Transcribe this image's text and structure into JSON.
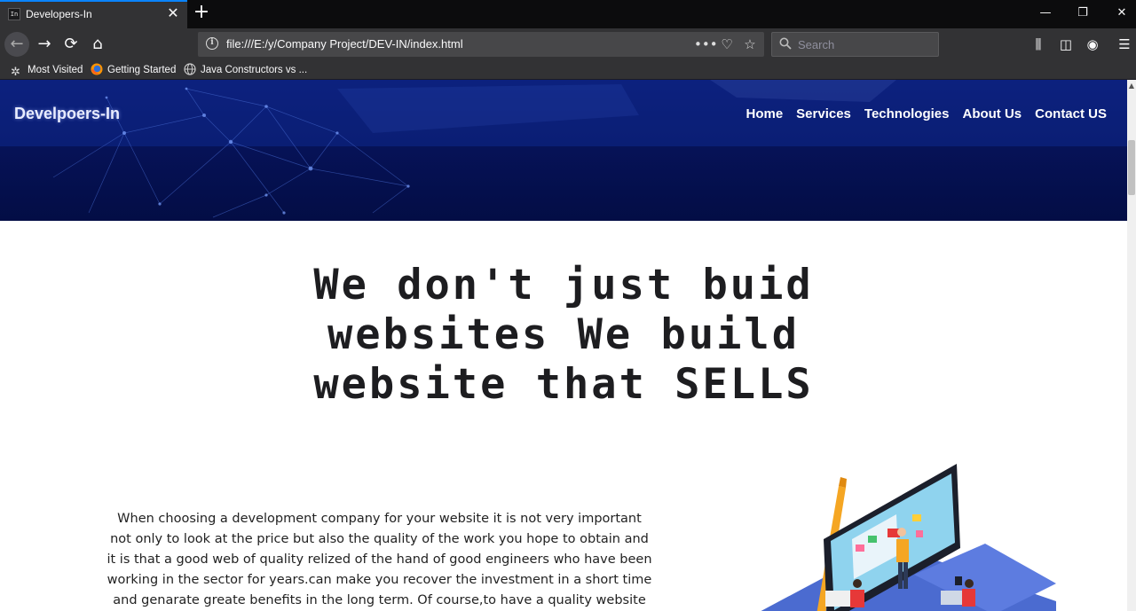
{
  "browser": {
    "tab": {
      "title": "Developers-In",
      "favicon_text": "In",
      "close_icon": "close-icon"
    },
    "new_tab_icon": "plus-icon",
    "window_controls": {
      "minimize": "—",
      "restore": "❐",
      "close": "✕"
    },
    "url": "file:///E:/y/Company Project/DEV-IN/index.html",
    "search_placeholder": "Search",
    "bookmarks": [
      {
        "label": "Most Visited",
        "icon": "gear-icon"
      },
      {
        "label": "Getting Started",
        "icon": "firefox-icon"
      },
      {
        "label": "Java Constructors vs ...",
        "icon": "globe-icon"
      }
    ]
  },
  "site": {
    "brand": "Develpoers-In",
    "nav": [
      "Home",
      "Services",
      "Technologies",
      "About Us",
      "Contact US"
    ],
    "headline": "We don't just buid websites We build website that SELLS",
    "intro": "When choosing a development company for your website it is not very important not only to look at the price but also the quality of the work you hope to obtain and it is that a good web of quality relized of the hand of good engineers who have been working in the sector for years.can make you recover the investment in a short time and genarate greate benefits in the long term. Of course,to have a quality website"
  },
  "colors": {
    "hero_top": "#0a1a6e",
    "hero_bottom": "#030d45",
    "chrome_dark": "#0c0c0d",
    "chrome": "#323234",
    "accent": "#0a84ff"
  }
}
